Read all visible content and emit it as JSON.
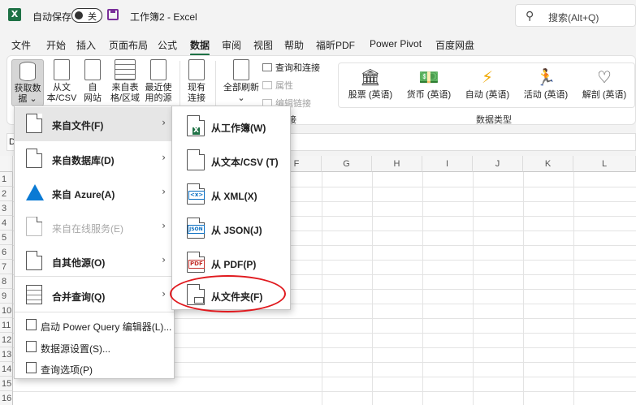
{
  "titlebar": {
    "autosave_label": "自动保存",
    "toggle_state": "关",
    "doc_title": "工作簿2  -  Excel",
    "search_placeholder": "搜索(Alt+Q)"
  },
  "menu": {
    "tabs": [
      "文件",
      "开始",
      "插入",
      "页面布局",
      "公式",
      "数据",
      "审阅",
      "视图",
      "帮助",
      "福昕PDF",
      "Power Pivot",
      "百度网盘"
    ],
    "active": "数据"
  },
  "ribbon": {
    "get_data": {
      "line1": "获取数",
      "line2": "据"
    },
    "from_text_csv": {
      "line1": "从文",
      "line2": "本/CSV"
    },
    "from_web": {
      "line1": "自",
      "line2": "网站"
    },
    "from_table": {
      "line1": "来自表",
      "line2": "格/区域"
    },
    "recent_sources": {
      "line1": "最近使",
      "line2": "用的源"
    },
    "existing_connections": {
      "line1": "现有",
      "line2": "连接"
    },
    "refresh_all": {
      "line1": "全部刷新"
    },
    "queries_connections": "查询和连接",
    "properties": "属性",
    "edit_links": "编辑链接",
    "group_suffix": "接",
    "data_types": [
      "股票 (英语)",
      "货币 (英语)",
      "自动 (英语)",
      "活动 (英语)",
      "解剖 (英语)"
    ],
    "data_types_group": "数据类型"
  },
  "formula_bar": {
    "namebox": "D"
  },
  "grid": {
    "columns": [
      "F",
      "G",
      "H",
      "I",
      "J",
      "K",
      "L"
    ],
    "rows": [
      "1",
      "2",
      "3",
      "4",
      "5",
      "6",
      "7",
      "8",
      "9",
      "10",
      "11",
      "12",
      "13",
      "14",
      "15",
      "16"
    ]
  },
  "dropdown": {
    "items": [
      {
        "label": "来自文件(F)",
        "state": "active"
      },
      {
        "label": "来自数据库(D)",
        "state": "normal"
      },
      {
        "label": "来自 Azure(A)",
        "state": "normal"
      },
      {
        "label": "来自在线服务(E)",
        "state": "disabled"
      },
      {
        "label": "自其他源(O)",
        "state": "normal"
      },
      {
        "label": "合并查询(Q)",
        "state": "normal"
      }
    ],
    "small_items": [
      "启动 Power Query 编辑器(L)...",
      "数据源设置(S)...",
      "查询选项(P)"
    ]
  },
  "submenu": {
    "items": [
      "从工作簿(W)",
      "从文本/CSV (T)",
      "从 XML(X)",
      "从 JSON(J)",
      "从 PDF(P)",
      "从文件夹(F)"
    ],
    "icon_tags": [
      "X",
      "",
      "<x>",
      "JSON",
      "PDF",
      ""
    ]
  },
  "colors": {
    "excel_green": "#1e7145",
    "highlight_red": "#e0191e",
    "save_purple": "#7a2f9a"
  }
}
